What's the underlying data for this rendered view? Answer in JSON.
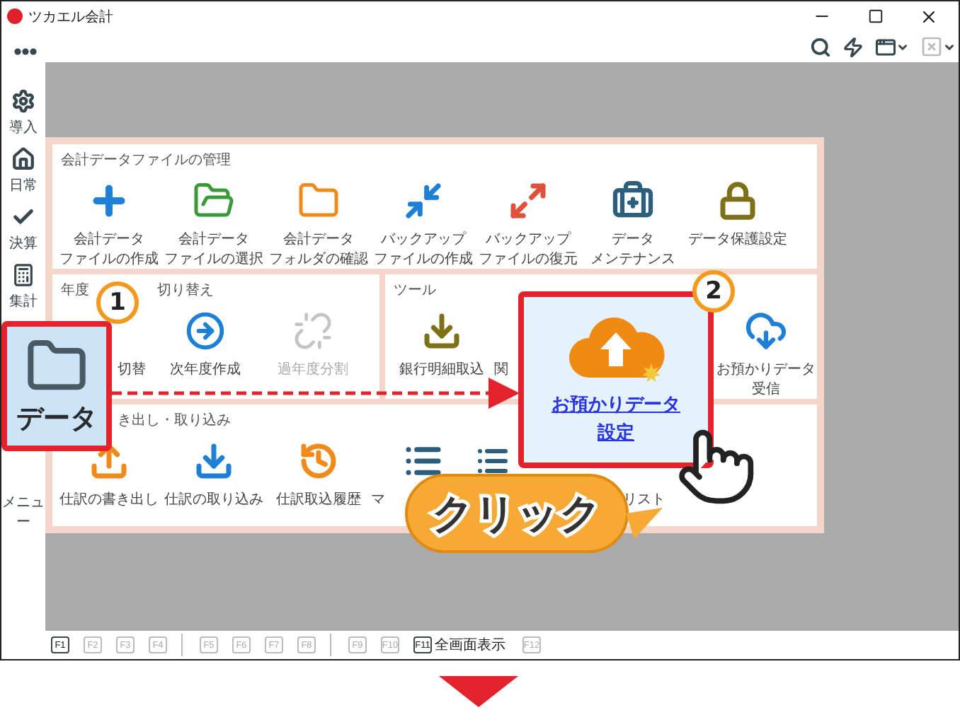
{
  "window": {
    "title": "ツカエル会計"
  },
  "sidebar": {
    "items": [
      {
        "label": "導入",
        "selected": false
      },
      {
        "label": "日常",
        "selected": false
      },
      {
        "label": "決算",
        "selected": false
      },
      {
        "label": "集計",
        "selected": false
      },
      {
        "label": "データ",
        "selected": true
      },
      {
        "label": "メニュー",
        "selected": false
      }
    ]
  },
  "panel": {
    "sections": [
      {
        "title_parts": [
          "会計データファイルの管理"
        ],
        "items": [
          {
            "lines": [
              "会計データ",
              "ファイルの作成"
            ],
            "kind": "full",
            "disabled": false
          },
          {
            "lines": [
              "会計データ",
              "ファイルの選択"
            ],
            "kind": "full",
            "disabled": false
          },
          {
            "lines": [
              "会計データ",
              "フォルダの確認"
            ],
            "kind": "full",
            "disabled": false
          },
          {
            "lines": [
              "バックアップ",
              "ファイルの作成"
            ],
            "kind": "full",
            "disabled": false
          },
          {
            "lines": [
              "バックアップ",
              "ファイルの復元"
            ],
            "kind": "full",
            "disabled": false
          },
          {
            "lines": [
              "データ",
              "メンテナンス"
            ],
            "kind": "full",
            "disabled": false
          },
          {
            "lines": [
              "データ保護設定"
            ],
            "kind": "full",
            "disabled": false
          }
        ]
      },
      {
        "title_parts": [
          "年度",
          "切り替え"
        ],
        "items": [
          {
            "lines": [
              "切替"
            ],
            "kind": "covered-left",
            "disabled": false
          },
          {
            "lines": [
              "次年度作成"
            ],
            "kind": "full",
            "disabled": false
          },
          {
            "lines": [
              "過年度分割"
            ],
            "kind": "full",
            "disabled": true
          }
        ]
      },
      {
        "title_parts": [
          "ツール"
        ],
        "items": [
          {
            "lines": [
              "銀行明細取込"
            ],
            "kind": "full",
            "disabled": false
          },
          {
            "lines": [
              "関"
            ],
            "kind": "covered-right",
            "disabled": false
          },
          {
            "lines": [
              "お預かりデータ",
              "設定"
            ],
            "kind": "highlighted",
            "disabled": false
          },
          {
            "lines": [
              "お預かりデータ",
              "受信"
            ],
            "kind": "full",
            "disabled": false
          }
        ]
      },
      {
        "title_parts": [
          "き出し・取り込み"
        ],
        "items": [
          {
            "lines": [
              "仕訳の書き出し"
            ],
            "kind": "full",
            "disabled": false
          },
          {
            "lines": [
              "仕訳の取り込み"
            ],
            "kind": "full",
            "disabled": false
          },
          {
            "lines": [
              "仕訳取込履歴"
            ],
            "kind": "full",
            "disabled": false
          },
          {
            "lines": [
              "マ"
            ],
            "kind": "covered-right",
            "disabled": false
          },
          {
            "lines": [
              "リスト"
            ],
            "kind": "covered-left",
            "disabled": false
          }
        ]
      }
    ]
  },
  "function_keys": [
    {
      "label": "F1",
      "enabled": true
    },
    {
      "label": "F2",
      "enabled": false
    },
    {
      "label": "F3",
      "enabled": false
    },
    {
      "label": "F4",
      "enabled": false
    },
    {
      "label": "F5",
      "enabled": false
    },
    {
      "label": "F6",
      "enabled": false
    },
    {
      "label": "F7",
      "enabled": false
    },
    {
      "label": "F8",
      "enabled": false
    },
    {
      "label": "F9",
      "enabled": false
    },
    {
      "label": "F10",
      "enabled": false
    },
    {
      "label": "F11",
      "enabled": true,
      "caption": "全画面表示"
    },
    {
      "label": "F12",
      "enabled": false
    }
  ],
  "annotations": {
    "steps": [
      "1",
      "2"
    ],
    "callout": "クリック"
  }
}
